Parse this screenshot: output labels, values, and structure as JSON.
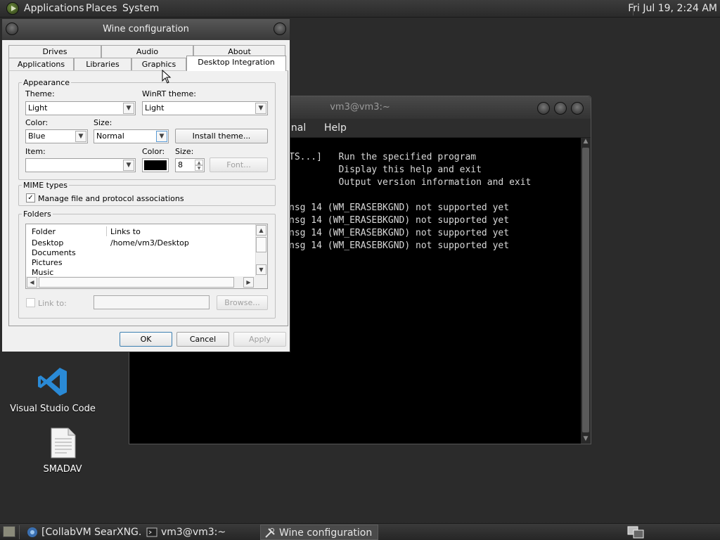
{
  "top_panel": {
    "menus": [
      "Applications",
      "Places",
      "System"
    ],
    "clock": "Fri Jul 19,  2:24 AM"
  },
  "desktop_icons": [
    {
      "label": "Visual Studio Code",
      "icon": "vscode-icon"
    },
    {
      "label": "SMADAV",
      "icon": "document-icon"
    }
  ],
  "terminal": {
    "title": "vm3@vm3:~",
    "menus": [
      "inal",
      "Help"
    ],
    "lines": [
      "TS...]   Run the specified program",
      "         Display this help and exit",
      "         Output version information and exit",
      "",
      "nsg 14 (WM_ERASEBKGND) not supported yet",
      "nsg 14 (WM_ERASEBKGND) not supported yet",
      "nsg 14 (WM_ERASEBKGND) not supported yet",
      "nsg 14 (WM_ERASEBKGND) not supported yet"
    ]
  },
  "wine": {
    "title": "Wine configuration",
    "tabs_row1": [
      "Drives",
      "Audio",
      "About"
    ],
    "tabs_row2": [
      "Applications",
      "Libraries",
      "Graphics",
      "Desktop Integration"
    ],
    "active_tab": "Desktop Integration",
    "appearance": {
      "legend": "Appearance",
      "theme_label": "Theme:",
      "theme_value": "Light",
      "winrt_label": "WinRT theme:",
      "winrt_value": "Light",
      "color_label": "Color:",
      "color_value": "Blue",
      "size_label": "Size:",
      "size_value": "Normal",
      "install_button": "Install theme...",
      "item_label": "Item:",
      "item_value": "",
      "item_color_label": "Color:",
      "item_color": "#000000",
      "item_size_label": "Size:",
      "item_size_value": "8",
      "font_button": "Font..."
    },
    "mime": {
      "legend": "MIME types",
      "checkbox_label": "Manage file and protocol associations",
      "checked": true
    },
    "folders": {
      "legend": "Folders",
      "columns": [
        "Folder",
        "Links to"
      ],
      "rows": [
        {
          "folder": "Desktop",
          "link": "/home/vm3/Desktop"
        },
        {
          "folder": "Documents",
          "link": ""
        },
        {
          "folder": "Pictures",
          "link": ""
        },
        {
          "folder": "Music",
          "link": ""
        }
      ],
      "link_label": "Link to:",
      "link_value": "",
      "browse_button": "Browse..."
    },
    "buttons": {
      "ok": "OK",
      "cancel": "Cancel",
      "apply": "Apply"
    }
  },
  "taskbar": {
    "tasks": [
      {
        "label": "[CollabVM SearXNG...",
        "icon": "browser-icon",
        "active": false
      },
      {
        "label": "vm3@vm3:~",
        "icon": "terminal-icon",
        "active": false
      },
      {
        "label": "Wine configuration",
        "icon": "tools-icon",
        "active": true
      }
    ]
  },
  "colors": {
    "panel_bg": "#2b2b2b",
    "dialog_bg": "#f0f0f0",
    "accent": "#3c7fb1"
  }
}
